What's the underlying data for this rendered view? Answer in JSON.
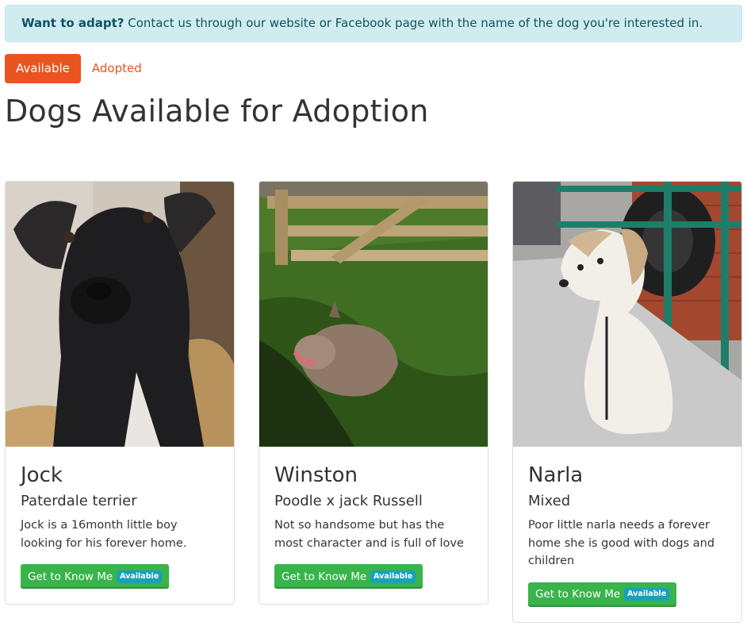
{
  "alert": {
    "bold": "Want to adapt?",
    "text": " Contact us through our website or Facebook page with the name of the dog you're interested in."
  },
  "tabs": [
    {
      "label": "Available",
      "active": true
    },
    {
      "label": "Adopted",
      "active": false
    }
  ],
  "page_title": "Dogs Available for Adoption",
  "colors": {
    "accent": "#e95420",
    "button": "#38b44a",
    "badge": "#17a2b8",
    "alert_bg": "#d1ecf1"
  },
  "dogs": [
    {
      "name": "Jock",
      "breed": "Paterdale terrier",
      "description": "Jock is a 16month little boy looking for his forever home.",
      "button_label": "Get to Know Me",
      "badge": "Available",
      "photo": "black-terrier-photo"
    },
    {
      "name": "Winston",
      "breed": "Poodle x jack Russell",
      "description": "Not so handsome but has the most character and is full of love",
      "button_label": "Get to Know Me",
      "badge": "Available",
      "photo": "scruffy-dog-on-grass-photo"
    },
    {
      "name": "Narla",
      "breed": "Mixed",
      "description": "Poor little narla needs a forever home she is good with dogs and children",
      "button_label": "Get to Know Me",
      "badge": "Available",
      "photo": "white-dog-on-metal-grate-photo"
    }
  ]
}
